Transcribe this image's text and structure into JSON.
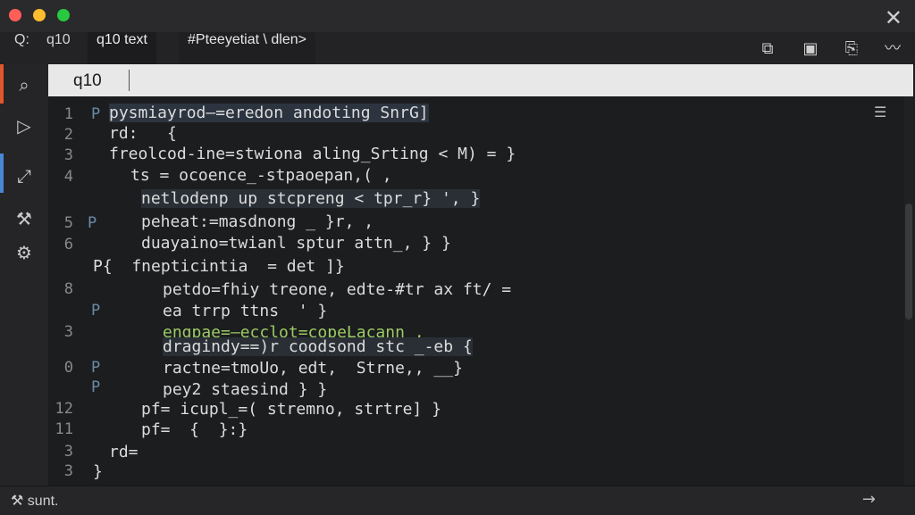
{
  "window": {
    "title": ""
  },
  "toolbar": {
    "tabs": [
      "Q:",
      "q10",
      "q10 text",
      "#Pteeyetiat \\ dlen>"
    ],
    "icons": [
      "split-editor-icon",
      "save-icon",
      "copy-icon",
      "chart-icon"
    ]
  },
  "sidebar": {
    "icons": [
      "search-icon",
      "run-icon",
      "extensions-icon",
      "wrench-icon",
      "gear-icon"
    ]
  },
  "search": {
    "value": "q10",
    "placeholder": ""
  },
  "editor": {
    "line_numbers": [
      "1",
      "2",
      "3",
      "4",
      "5",
      "6",
      "8",
      "3",
      "0",
      "12",
      "11",
      "3",
      "3"
    ],
    "lines": [
      {
        "text": "pysmiayrod—=eredon andoting SnrG]"
      },
      {
        "text": "rd:   {"
      },
      {
        "text": "freolcod-ine=stwiona aling_Srting < M) = }"
      },
      {
        "text": "ts = ocoence_-stpaoepan,( ,"
      },
      {
        "text": "netlodenp up stcpreng < tpr_r} ', }"
      },
      {
        "text": "peheat:=masdnong _ }r, ,"
      },
      {
        "text": "duayaino=twianl sptur attn_, } }"
      },
      {
        "text": "P{  fnepticintia  = det ]}"
      },
      {
        "text": "petdo=fhiy treone, edte-#tr ax ft/ ="
      },
      {
        "text": "ea trrp ttns  ' }"
      },
      {
        "text": "engpae=—ecclot=copeLacann_,"
      },
      {
        "text": "dragindy==)r coodsond stc _-eb {"
      },
      {
        "text": "ractne=tmoUo, edt,  Strne,, __}"
      },
      {
        "text": "pey2 staesind } }"
      },
      {
        "text": "pf= icupl_=( stremno, strtre] }"
      },
      {
        "text": "pf=  {  }:}"
      },
      {
        "text": "rd="
      },
      {
        "text": "}"
      }
    ]
  },
  "status": {
    "left": "sunt.",
    "right_icon": "arrow-right-icon"
  }
}
